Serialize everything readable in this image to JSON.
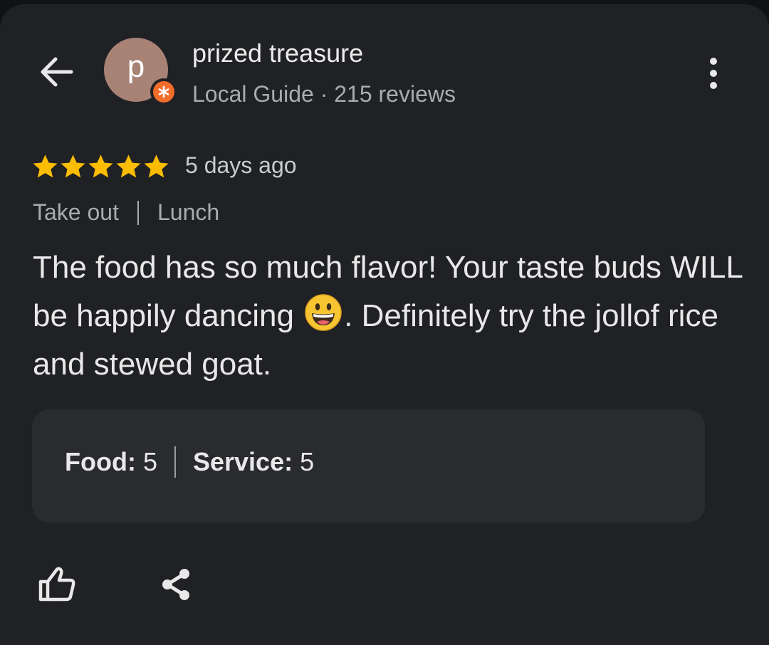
{
  "header": {
    "avatar_initial": "p",
    "user_name": "prized treasure",
    "user_meta": "Local Guide · 215 reviews",
    "icons": [
      "arrow-left-icon",
      "local-guide-badge-icon",
      "more-vertical-icon"
    ]
  },
  "review": {
    "rating": 5,
    "rating_max": 5,
    "posted": "5 days ago",
    "tags": [
      "Take out",
      "Lunch"
    ],
    "text_before_emoji": "The food has so much flavor! Your taste buds WILL be happily dancing ",
    "emoji": "grinning-face-emoji",
    "text_after_emoji": ". Definitely try the jollof rice and stewed goat.",
    "sub_ratings": [
      {
        "label": "Food:",
        "value": "5"
      },
      {
        "label": "Service:",
        "value": "5"
      }
    ]
  },
  "actions": {
    "icons": [
      "thumbs-up-icon",
      "share-icon"
    ]
  },
  "colors": {
    "card_bg": "#202124",
    "ratings_box_bg": "#2a2b2f",
    "star": "#fbbc04",
    "guide_badge": "#f26c2a",
    "avatar_bg": "#a78275"
  }
}
